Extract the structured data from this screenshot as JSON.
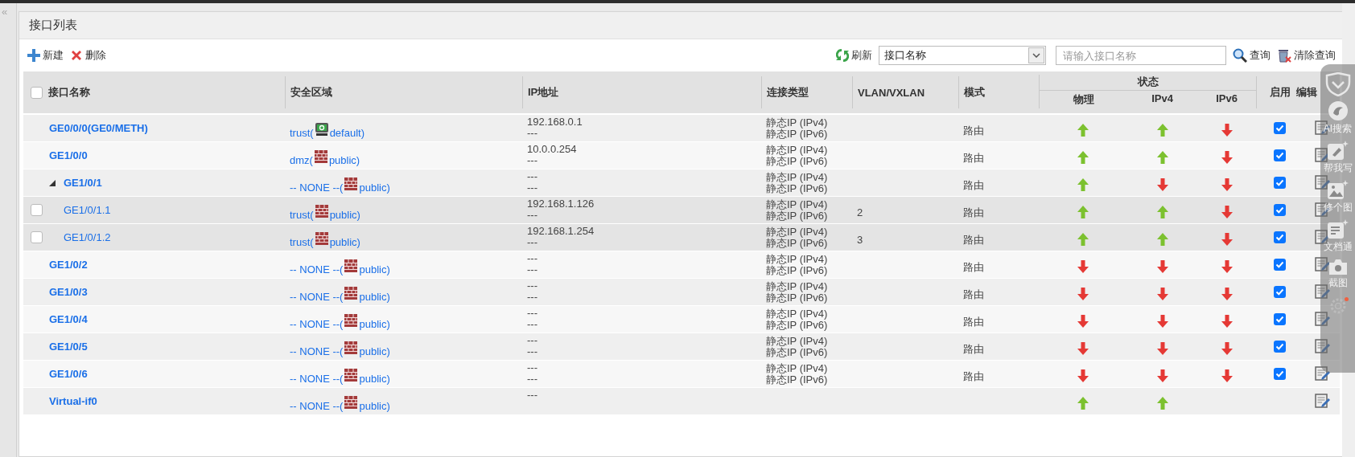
{
  "collapse_toggle": "«",
  "panel": {
    "title": "接口列表"
  },
  "toolbar": {
    "new_label": "新建",
    "delete_label": "删除",
    "refresh_label": "刷新",
    "filter_select": "接口名称",
    "search": {
      "placeholder": "请输入接口名称"
    },
    "query_label": "查询",
    "clear_label": "清除查询"
  },
  "table": {
    "select_all_checked": false,
    "columns": [
      "接口名称",
      "安全区域",
      "IP地址",
      "连接类型",
      "VLAN/VXLAN",
      "模式"
    ],
    "status_group": "状态",
    "status_columns": [
      "物理",
      "IPv4",
      "IPv6"
    ],
    "trailing_columns": [
      "启用",
      "编辑"
    ],
    "rows": [
      {
        "name": "GE0/0/0(GE0/METH)",
        "zone_text": "trust(",
        "vsys_root": true,
        "vsys_text": "default)",
        "ip": [
          "192.168.0.1",
          "---"
        ],
        "connection": [
          "静态IP (IPv4)",
          "静态IP (IPv6)"
        ],
        "mode": "路由",
        "physical_up": true,
        "ipv4_up": true,
        "ipv6_up": false,
        "enabled": true
      },
      {
        "name": "GE1/0/0",
        "zone_text": "dmz(",
        "vsys_root": false,
        "vsys_text": "public)",
        "ip": [
          "10.0.0.254",
          "---"
        ],
        "connection": [
          "静态IP (IPv4)",
          "静态IP (IPv6)"
        ],
        "mode": "路由",
        "physical_up": true,
        "ipv4_up": true,
        "ipv6_up": false,
        "enabled": true
      },
      {
        "name": "GE1/0/1",
        "zone_text": "-- NONE --(",
        "vsys_root": false,
        "vsys_text": "public)",
        "ip": [
          "---",
          "---"
        ],
        "connection": [
          "静态IP (IPv4)",
          "静态IP (IPv6)"
        ],
        "mode": "路由",
        "physical_up": true,
        "ipv4_up": false,
        "ipv6_up": false,
        "enabled": true,
        "expanded": true,
        "children": [
          {
            "name": "GE1/0/1.1",
            "checked": false,
            "zone_text": "trust(",
            "vsys_root": false,
            "vsys_text": "public)",
            "ip": [
              "192.168.1.126",
              "---"
            ],
            "connection": [
              "静态IP (IPv4)",
              "静态IP (IPv6)"
            ],
            "vlan": "2",
            "mode": "路由",
            "physical_up": true,
            "ipv4_up": true,
            "ipv6_up": false,
            "enabled": true
          },
          {
            "name": "GE1/0/1.2",
            "checked": false,
            "zone_text": "trust(",
            "vsys_root": false,
            "vsys_text": "public)",
            "ip": [
              "192.168.1.254",
              "---"
            ],
            "connection": [
              "静态IP (IPv4)",
              "静态IP (IPv6)"
            ],
            "vlan": "3",
            "mode": "路由",
            "physical_up": true,
            "ipv4_up": true,
            "ipv6_up": false,
            "enabled": true
          }
        ]
      },
      {
        "name": "GE1/0/2",
        "zone_text": "-- NONE --(",
        "vsys_root": false,
        "vsys_text": "public)",
        "ip": [
          "---",
          "---"
        ],
        "connection": [
          "静态IP (IPv4)",
          "静态IP (IPv6)"
        ],
        "mode": "路由",
        "physical_up": false,
        "ipv4_up": false,
        "ipv6_up": false,
        "enabled": true
      },
      {
        "name": "GE1/0/3",
        "zone_text": "-- NONE --(",
        "vsys_root": false,
        "vsys_text": "public)",
        "ip": [
          "---",
          "---"
        ],
        "connection": [
          "静态IP (IPv4)",
          "静态IP (IPv6)"
        ],
        "mode": "路由",
        "physical_up": false,
        "ipv4_up": false,
        "ipv6_up": false,
        "enabled": true
      },
      {
        "name": "GE1/0/4",
        "zone_text": "-- NONE --(",
        "vsys_root": false,
        "vsys_text": "public)",
        "ip": [
          "---",
          "---"
        ],
        "connection": [
          "静态IP (IPv4)",
          "静态IP (IPv6)"
        ],
        "mode": "路由",
        "physical_up": false,
        "ipv4_up": false,
        "ipv6_up": false,
        "enabled": true
      },
      {
        "name": "GE1/0/5",
        "zone_text": "-- NONE --(",
        "vsys_root": false,
        "vsys_text": "public)",
        "ip": [
          "---",
          "---"
        ],
        "connection": [
          "静态IP (IPv4)",
          "静态IP (IPv6)"
        ],
        "mode": "路由",
        "physical_up": false,
        "ipv4_up": false,
        "ipv6_up": false,
        "enabled": true
      },
      {
        "name": "GE1/0/6",
        "zone_text": "-- NONE --(",
        "vsys_root": false,
        "vsys_text": "public)",
        "ip": [
          "---",
          "---"
        ],
        "connection": [
          "静态IP (IPv4)",
          "静态IP (IPv6)"
        ],
        "mode": "路由",
        "physical_up": false,
        "ipv4_up": false,
        "ipv6_up": false,
        "enabled": true
      },
      {
        "name": "Virtual-if0",
        "zone_text": "-- NONE --(",
        "vsys_root": false,
        "vsys_text": "public)",
        "ip": [
          "---"
        ],
        "physical_up": true,
        "ipv4_up": true
      }
    ]
  },
  "assistant_sidebar": {
    "items": [
      {
        "kind": "shield"
      },
      {
        "kind": "search",
        "label": "AI搜索"
      },
      {
        "kind": "write",
        "label": "帮我写"
      },
      {
        "kind": "image",
        "label": "修个图"
      },
      {
        "kind": "doc",
        "label": "文档通"
      },
      {
        "kind": "camera",
        "label": "截图",
        "badge": true
      },
      {
        "kind": "settings"
      }
    ]
  }
}
